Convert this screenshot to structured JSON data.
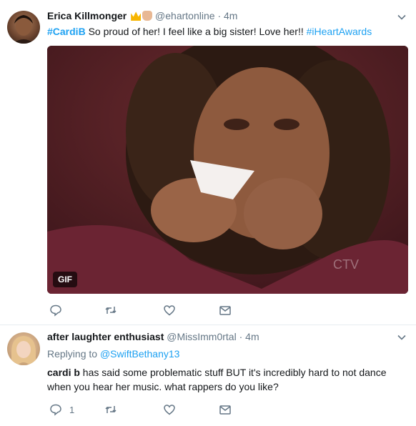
{
  "tweets": [
    {
      "display_name": "Erica Killmonger",
      "handle": "@ehartonline",
      "separator": "·",
      "time": "4m",
      "text_parts": {
        "hashtag1": "#CardiB",
        "body": " So proud of her! I feel like a big sister! Love her!! ",
        "hashtag2": "#iHeartAwards"
      },
      "media_badge": "GIF",
      "media_watermark": "CTV",
      "emojis": [
        "crown-icon",
        "fist-icon"
      ]
    },
    {
      "display_name": "after laughter enthusiast",
      "handle": "@MissImm0rtal",
      "separator": "·",
      "time": "4m",
      "replying_label": "Replying to ",
      "replying_to": "@SwiftBethany13",
      "text_parts": {
        "bold": "cardi b",
        "body": " has said some problematic stuff BUT it's incredibly hard to not dance when you hear her music. what rappers do you like?"
      },
      "reply_count": "1"
    }
  ],
  "colors": {
    "link": "#1da1f2",
    "muted": "#657786",
    "text": "#14171a"
  }
}
